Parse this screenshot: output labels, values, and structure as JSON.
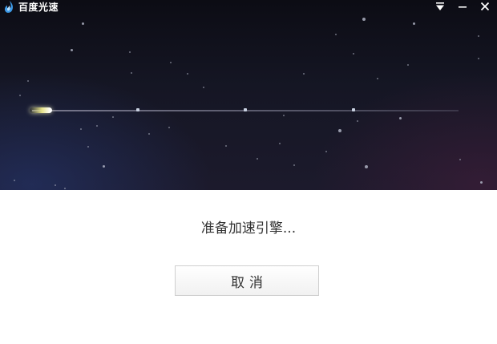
{
  "window": {
    "title": "百度光速",
    "logo_icon": "baidu-flame-icon",
    "controls": [
      "dropdown-menu-icon",
      "minimize-icon",
      "close-icon"
    ]
  },
  "banner": {
    "background_colors": [
      "#0c0c14",
      "#1c1a2c"
    ],
    "track_color": "#8c8ca0",
    "meteor_color": "#e6e38a"
  },
  "status": {
    "message": "准备加速引擎..."
  },
  "buttons": {
    "cancel_label": "取消"
  }
}
